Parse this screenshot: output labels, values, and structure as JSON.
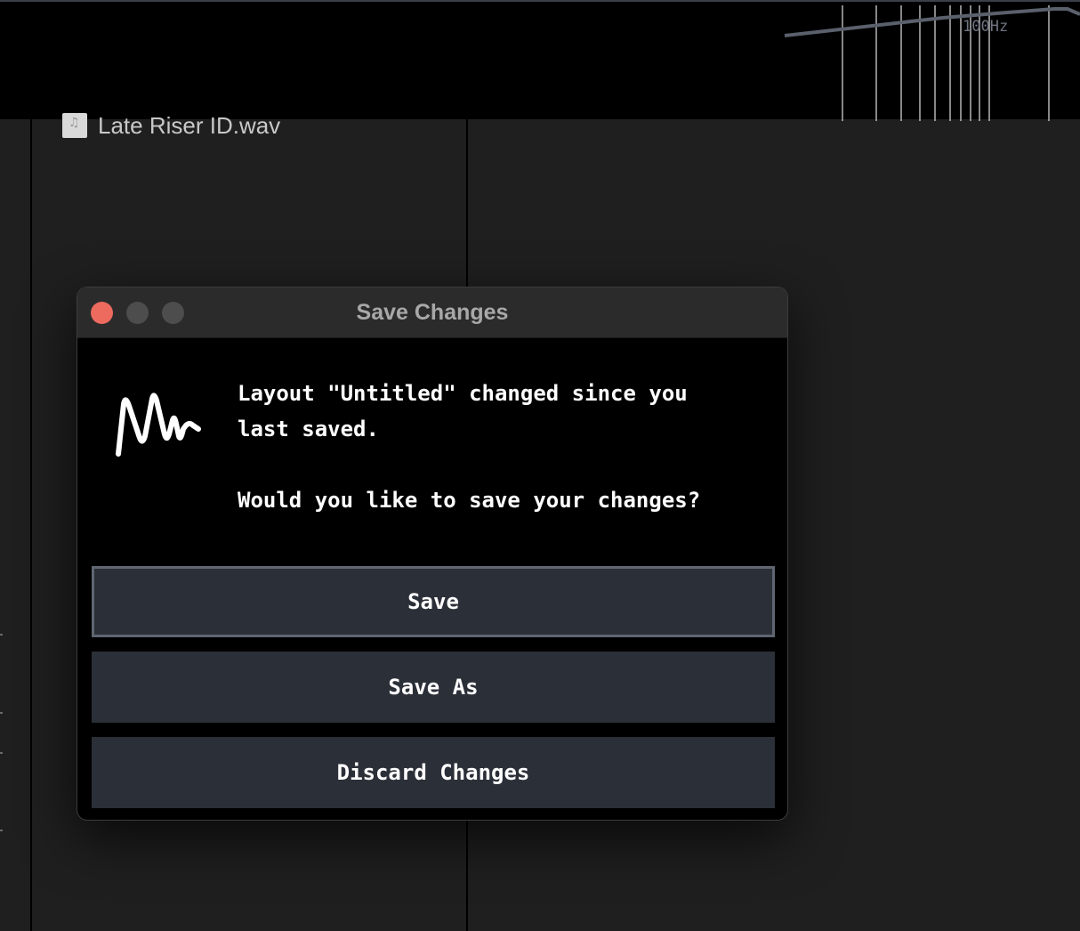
{
  "analyzer": {
    "freq_label": "100Hz"
  },
  "file_browser": {
    "file_name": "Late Riser ID.wav"
  },
  "dialog": {
    "title": "Save Changes",
    "message_line1": "Layout \"Untitled\" changed since you",
    "message_line2": "last saved.",
    "question": "Would you like to save your changes?",
    "buttons": {
      "save": "Save",
      "save_as": "Save As",
      "discard": "Discard Changes"
    }
  },
  "colors": {
    "close_button": "#ed6a5e",
    "button_bg": "#2b2f38",
    "focus_border": "#5f6672"
  },
  "icons": {
    "app_logo": "waveform-m-logo",
    "file": "audio-file-icon"
  }
}
